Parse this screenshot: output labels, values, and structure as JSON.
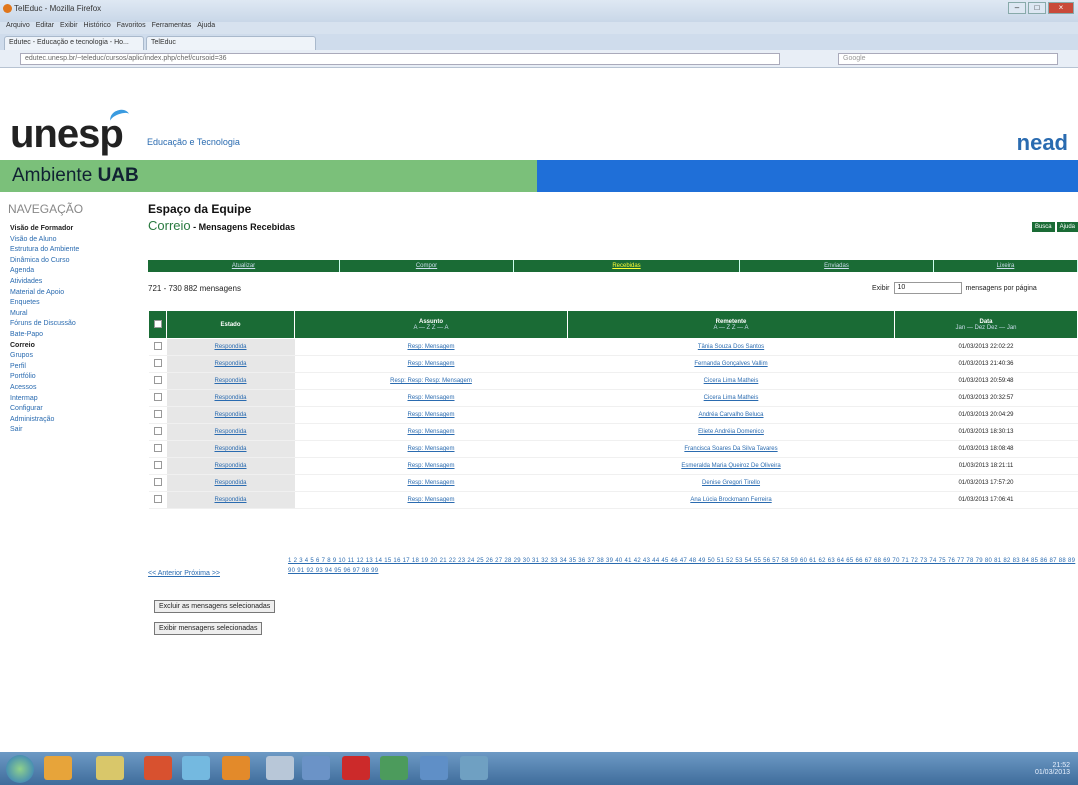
{
  "browser": {
    "title": "TelEduc - Mozilla Firefox",
    "menus": [
      "Arquivo",
      "Editar",
      "Exibir",
      "Histórico",
      "Favoritos",
      "Ferramentas",
      "Ajuda"
    ],
    "tabs": [
      "Edutec - Educação e tecnologia - Ho...",
      "TelEduc"
    ],
    "url": "edutec.unesp.br/~teleduc/cursos/aplic/index.php/chef/cursoid=36",
    "search": "Google"
  },
  "header": {
    "logo": "unesp",
    "subtitle": "Educação e Tecnologia",
    "nead": "nead",
    "band_title": "Ambiente",
    "band_bold": "UAB"
  },
  "sidebar": {
    "heading": "NAVEGAÇÃO",
    "items": [
      {
        "label": "Visão de Formador",
        "bold": true
      },
      {
        "label": "Visão de Aluno"
      },
      {
        "label": ""
      },
      {
        "label": "Estrutura do Ambiente"
      },
      {
        "label": "Dinâmica do Curso"
      },
      {
        "label": "Agenda"
      },
      {
        "label": "Atividades"
      },
      {
        "label": "Material de Apoio"
      },
      {
        "label": "Enquetes"
      },
      {
        "label": ""
      },
      {
        "label": "Mural"
      },
      {
        "label": "Fóruns de Discussão"
      },
      {
        "label": "Bate-Papo"
      },
      {
        "label": "Correio",
        "bold": true
      },
      {
        "label": "Grupos"
      },
      {
        "label": "Perfil"
      },
      {
        "label": "Portfólio"
      },
      {
        "label": "Acessos"
      },
      {
        "label": "Intermap"
      },
      {
        "label": ""
      },
      {
        "label": "Configurar"
      },
      {
        "label": "Administração"
      },
      {
        "label": ""
      },
      {
        "label": "Sair"
      }
    ]
  },
  "page": {
    "title": "Espaço da Equipe",
    "section": "Correio",
    "section_sub": " - Mensagens Recebidas",
    "small_buttons": [
      "Busca",
      "Ajuda"
    ],
    "nav": [
      "Atualizar",
      "Compor",
      "Recebidas",
      "Enviadas",
      "Lixeira"
    ],
    "count": "721 - 730 882 mensagens",
    "exibir": "Exibir",
    "exibir_value": "10",
    "per_page": "mensagens por página"
  },
  "table": {
    "headers": {
      "estado": "Estado",
      "assunto": "Assunto",
      "assunto_sort": "A — Z  Z — A",
      "remetente": "Remetente",
      "remetente_sort": "A — Z  Z — A",
      "data": "Data",
      "data_sort": "Jan — Dez  Dez — Jan"
    },
    "rows": [
      {
        "estado": "Respondida",
        "assunto": "Resp: Mensagem",
        "remetente": "Tânia Souza Dos Santos",
        "data": "01/03/2013 22:02:22"
      },
      {
        "estado": "Respondida",
        "assunto": "Resp: Mensagem",
        "remetente": "Fernanda Gonçalves Vallim",
        "data": "01/03/2013 21:40:36"
      },
      {
        "estado": "Respondida",
        "assunto": "Resp: Resp: Resp: Mensagem",
        "remetente": "Cicera Lima Matheis",
        "data": "01/03/2013 20:59:48"
      },
      {
        "estado": "Respondida",
        "assunto": "Resp: Mensagem",
        "remetente": "Cicera Lima Matheis",
        "data": "01/03/2013 20:32:57"
      },
      {
        "estado": "Respondida",
        "assunto": "Resp: Mensagem",
        "remetente": "Andréa Carvalho Beluca",
        "data": "01/03/2013 20:04:29"
      },
      {
        "estado": "Respondida",
        "assunto": "Resp: Mensagem",
        "remetente": "Eliete Andréia Domenico",
        "data": "01/03/2013 18:30:13"
      },
      {
        "estado": "Respondida",
        "assunto": "Resp: Mensagem",
        "remetente": "Francisca Soares Da Silva Tavares",
        "data": "01/03/2013 18:08:48"
      },
      {
        "estado": "Respondida",
        "assunto": "Resp: Mensagem",
        "remetente": "Esmeralda Maria Queiroz De Oliveira",
        "data": "01/03/2013 18:21:11"
      },
      {
        "estado": "Respondida",
        "assunto": "Resp: Mensagem",
        "remetente": "Denise Gregori Tirello",
        "data": "01/03/2013 17:57:20"
      },
      {
        "estado": "Respondida",
        "assunto": "Resp: Mensagem",
        "remetente": "Ana Lúcia Brockmann Ferreira",
        "data": "01/03/2013 17:06:41"
      }
    ]
  },
  "pager": {
    "prev": "<< Anterior",
    "next": "Próxima >>",
    "current": "73",
    "pages": "1 2 3 4 5 6 7 8 9 10 11 12 13 14 15 16 17 18 19 20 21 22 23 24 25 26 27 28 29 30 31 32 33 34 35 36 37 38 39 40 41 42 43 44 45 46 47 48 49 50 51 52 53 54 55 56 57 58 59 60 61 62 63 64 65 66 67 68 69 70 71 72 73 74 75 76 77 78 79 80 81 82 83 84 85 86 87 88 89 90 91 92 93 94 95 96 97 98 99"
  },
  "actions": {
    "delete": "Excluir as mensagens selecionadas",
    "show": "Exibir mensagens selecionadas"
  },
  "taskbar": {
    "time": "21:52",
    "date": "01/03/2013"
  }
}
